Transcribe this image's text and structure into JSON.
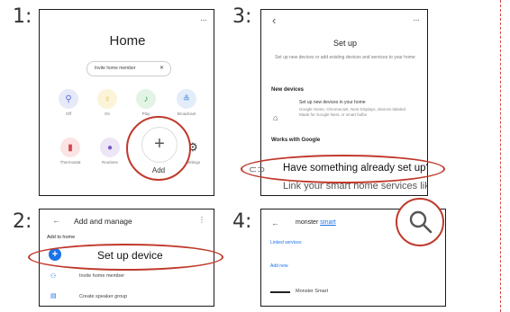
{
  "steps": [
    "1:",
    "2:",
    "3:",
    "4:"
  ],
  "panel1": {
    "menu_dots": "···",
    "title": "Home",
    "invite_chip": "Invite home member",
    "chip_close": "✕",
    "row1": [
      {
        "label": "Off",
        "icon": "lightbulb-icon",
        "color": "#e6e9f7",
        "icon_color": "#5a6cd6",
        "glyph": "⚲"
      },
      {
        "label": "On",
        "icon": "lightbulb-icon",
        "color": "#fbf4d9",
        "icon_color": "#e2b33b",
        "glyph": "♀"
      },
      {
        "label": "Play",
        "icon": "music-icon",
        "color": "#e3f4e6",
        "icon_color": "#39a55a",
        "glyph": "♪"
      },
      {
        "label": "Broadcast",
        "icon": "broadcast-icon",
        "color": "#e3edf9",
        "icon_color": "#3d7ed6",
        "glyph": "≗"
      }
    ],
    "row2": [
      {
        "label": "Thermostat",
        "icon": "thermostat-icon",
        "color": "#fbe3e3",
        "icon_color": "#d44848",
        "glyph": "▮"
      },
      {
        "label": "Routines",
        "icon": "routines-icon",
        "color": "#ece6f7",
        "icon_color": "#7b57c9",
        "glyph": "●"
      },
      {
        "label": "Settings",
        "icon": "gear-icon",
        "color": "#ffffff",
        "icon_color": "#333333",
        "glyph": "⚙"
      }
    ],
    "add_plus": "+",
    "add_label": "Add"
  },
  "panel2": {
    "back": "←",
    "title": "Add and manage",
    "menu": "⋮",
    "section": "Add to home",
    "setup_device": "Set up device",
    "setup_plus": "+",
    "invite": "Invite home member",
    "create_speaker": "Create speaker group"
  },
  "panel3": {
    "back": "‹",
    "menu_dots": "···",
    "title": "Set up",
    "subtitle": "Set up new devices or add existing devices and services to your home",
    "new_devices": "New devices",
    "new_devices_title": "Set up new devices in your home",
    "new_devices_desc": "Google Home, Chromecast, Nest Displays, devices labeled Made for Google Nest, or smart bulbs",
    "works_with": "Works with Google",
    "have_something": "Have something already set up?",
    "link_services": "Link your smart home services like Phi"
  },
  "panel4": {
    "back": "←",
    "query_1": "monster ",
    "query_2": "smart",
    "linked_services": "Linked services",
    "add_new": "Add new",
    "result": "Monster Smart"
  }
}
